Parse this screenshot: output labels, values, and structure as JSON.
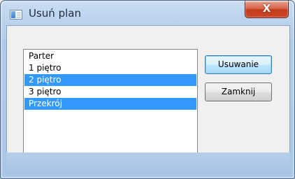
{
  "window": {
    "title": "Usuń plan",
    "close_symbol": "X",
    "icon": "window-app-icon"
  },
  "floors": {
    "items": [
      {
        "label": "Parter",
        "selected": false
      },
      {
        "label": "1 piętro",
        "selected": false
      },
      {
        "label": "2 piętro",
        "selected": true
      },
      {
        "label": "3 piętro",
        "selected": false
      },
      {
        "label": "Przekrój",
        "selected": true
      }
    ]
  },
  "buttons": {
    "remove_label": "Usuwanie",
    "close_label": "Zamknij"
  },
  "colors": {
    "selection": "#3399ff",
    "close_button": "#c53a1b",
    "frame": "#b9d1ea"
  }
}
